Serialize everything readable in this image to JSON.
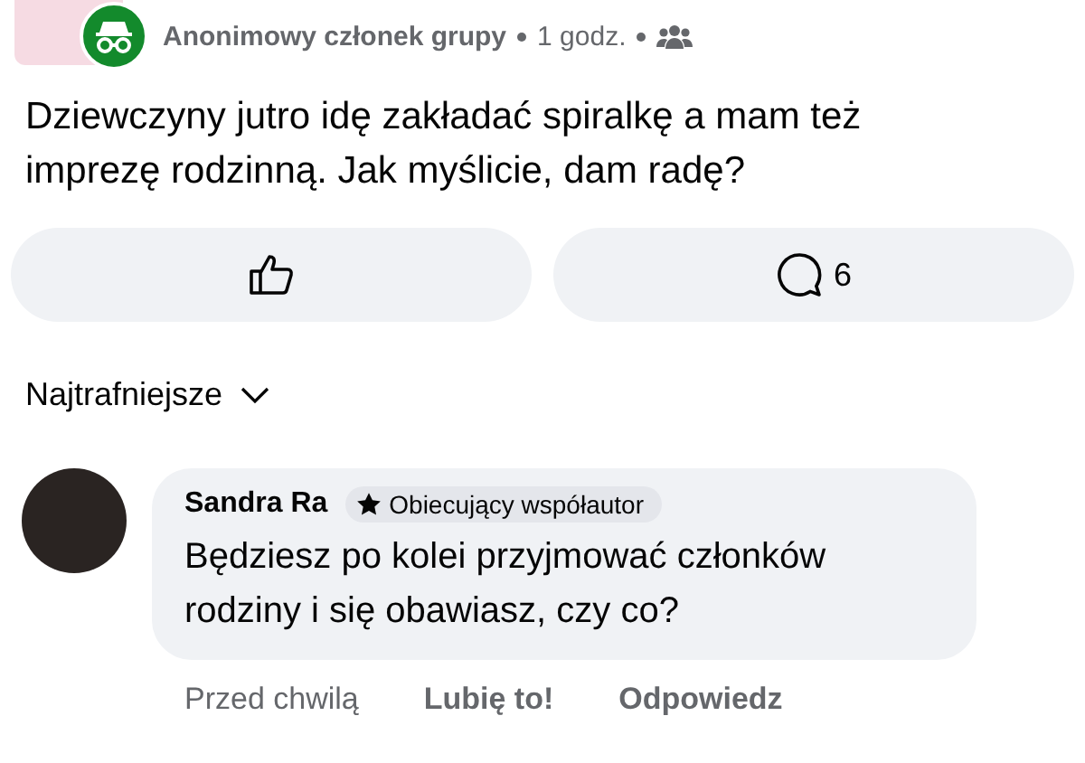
{
  "post": {
    "author": "Anonimowy członek grupy",
    "time": "1 godz.",
    "text": "Dziewczyny jutro idę zakładać spiralkę a mam też imprezę rodzinną. Jak myślicie, dam radę?"
  },
  "actions": {
    "comment_count": "6"
  },
  "sort": {
    "label": "Najtrafniejsze"
  },
  "comment": {
    "author": "Sandra Ra",
    "badge": "Obiecujący współautor",
    "text": "Będziesz po kolei przyjmować członków rodziny i się obawiasz, czy co?",
    "time": "Przed chwilą",
    "like": "Lubię to!",
    "reply": "Odpowiedz"
  }
}
